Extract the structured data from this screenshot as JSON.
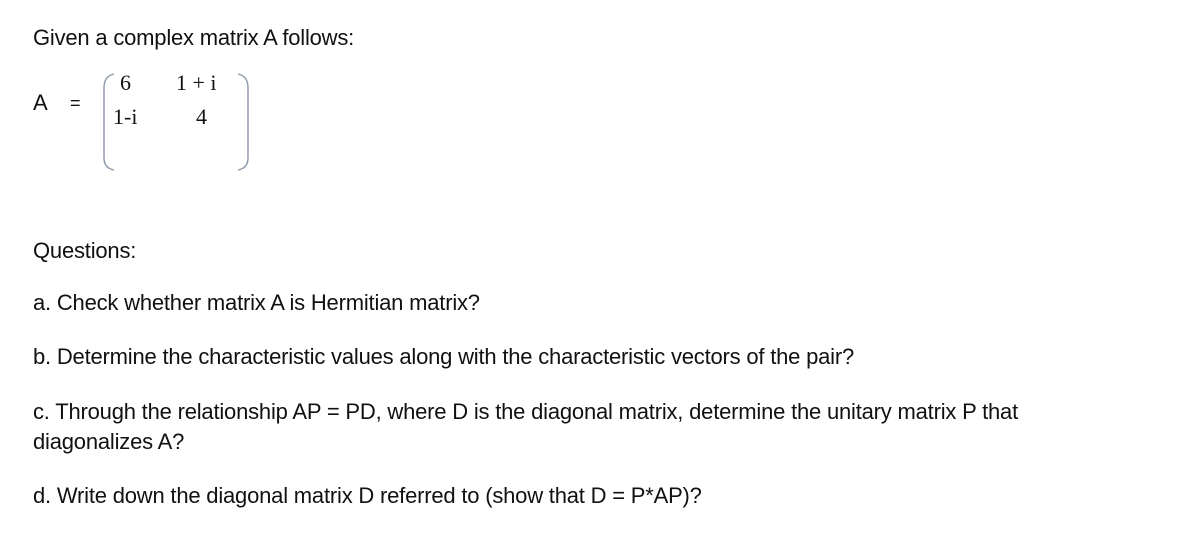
{
  "intro": "Given a complex matrix A follows:",
  "matrix": {
    "label": "A",
    "equals": "=",
    "rows": [
      [
        "6",
        "1 + i"
      ],
      [
        "1-i",
        "4"
      ]
    ]
  },
  "questions": {
    "heading": "Questions:",
    "a": "a. Check whether matrix A is Hermitian matrix?",
    "b": "b. Determine the characteristic values along with the characteristic vectors of the pair?",
    "c_line1": "c. Through the relationship AP = PD, where D is the diagonal matrix, determine the unitary matrix P that",
    "c_line2": "diagonalizes A?",
    "d": "d. Write down the diagonal matrix D referred to (show that D = P*AP)?"
  },
  "colors": {
    "text": "#111111",
    "bracket": "#8a96a8",
    "background": "#ffffff"
  }
}
